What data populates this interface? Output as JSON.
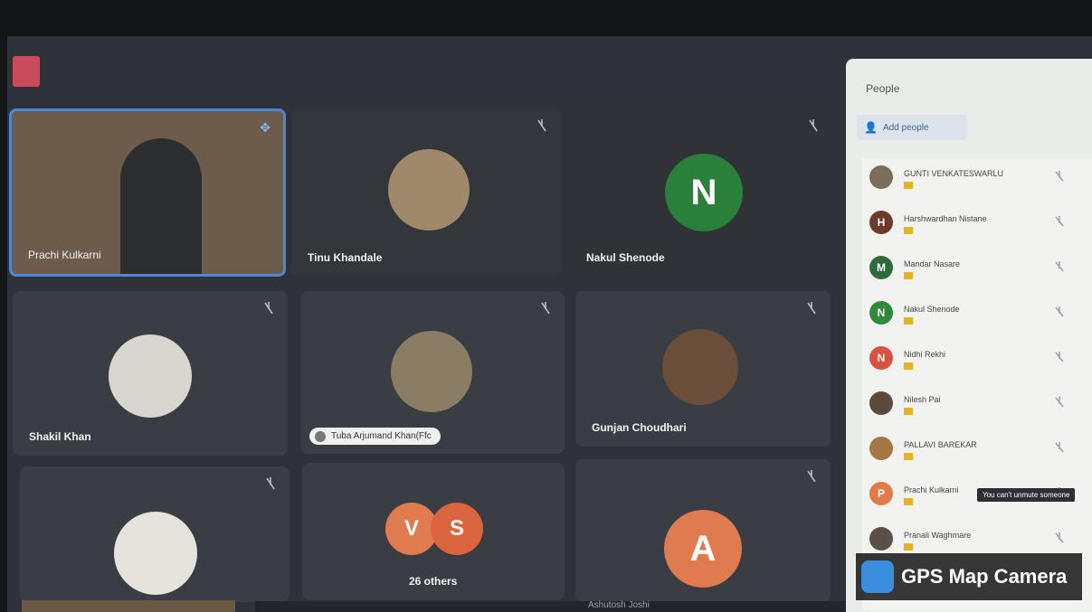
{
  "tiles": [
    {
      "name": "Prachi Kulkarni"
    },
    {
      "name": "Tinu Khandale"
    },
    {
      "name": "Nakul Shenode",
      "initial": "N"
    },
    {
      "name": "Shakil Khan"
    },
    {
      "name": "Tuba Arjumand Khan(Ffc"
    },
    {
      "name": "Gunjan Choudhari"
    },
    {
      "name": ""
    },
    {
      "name": "26 others",
      "initials": [
        "V",
        "S"
      ]
    },
    {
      "name": "",
      "initial": "A"
    }
  ],
  "people_panel": {
    "title": "People",
    "add_label": "Add people",
    "participants": [
      {
        "name": "GUNTI VENKATESWARLU",
        "initial": "",
        "color": "#7a6d5a"
      },
      {
        "name": "Harshwardhan Nistane",
        "initial": "H",
        "color": "#6b3a2a"
      },
      {
        "name": "Mandar Nasare",
        "initial": "M",
        "color": "#2e6b3c"
      },
      {
        "name": "Nakul Shenode",
        "initial": "N",
        "color": "#2f8a3c"
      },
      {
        "name": "Nidhi Rekhi",
        "initial": "N",
        "color": "#d9523f"
      },
      {
        "name": "Nilesh Pai",
        "initial": "",
        "color": "#5b4a3b"
      },
      {
        "name": "PALLAVI BAREKAR",
        "initial": "",
        "color": "#a57744"
      },
      {
        "name": "Prachi Kulkarni",
        "initial": "P",
        "color": "#e27a46"
      },
      {
        "name": "Pranali Waghmare",
        "initial": "",
        "color": "#5a5049"
      }
    ],
    "tooltip": "You can't unmute someone"
  },
  "watermark": "GPS Map Camera",
  "bottom_name": "Ashutosh Joshi"
}
